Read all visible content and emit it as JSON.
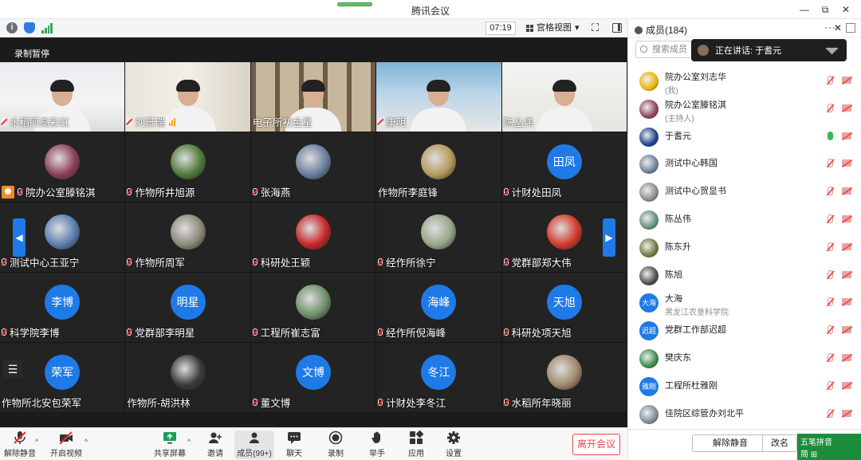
{
  "window": {
    "title": "腾讯会议",
    "controls": [
      "—",
      "⧉",
      "✕"
    ]
  },
  "toolbar": {
    "time": "07:19",
    "view_label": "宫格视图",
    "view_caret": "▾",
    "fullscreen": "⛶"
  },
  "recording_status": "录制暂停",
  "tiles": [
    {
      "name": "水稻所高彩虹",
      "type": "camera",
      "scene": "s1"
    },
    {
      "name": "刘景瑞",
      "type": "camera",
      "scene": "s2",
      "bars": true
    },
    {
      "name": "电子所初金星",
      "type": "camera",
      "scene": "s3",
      "nomic": true
    },
    {
      "name": "康明",
      "type": "camera",
      "scene": "s4"
    },
    {
      "name": "陈丛伟",
      "type": "camera",
      "scene": "s5",
      "nomic": true
    },
    {
      "name": "院办公室滕铭淇",
      "type": "avatar",
      "host": true,
      "color": "#8e3f5a"
    },
    {
      "name": "作物所井旭源",
      "type": "avatar",
      "color": "#4f7a3a"
    },
    {
      "name": "张海燕",
      "type": "avatar",
      "color": "#6a7fa0"
    },
    {
      "name": "作物所李庭锋",
      "type": "avatar",
      "nomic": true,
      "color": "#b69a5c"
    },
    {
      "name": "计财处田凤",
      "type": "text",
      "text": "田凤"
    },
    {
      "name": "测试中心王亚宁",
      "type": "avatar",
      "color": "#5a7fb0"
    },
    {
      "name": "作物所周军",
      "type": "avatar",
      "color": "#8d8a7a"
    },
    {
      "name": "科研处王颖",
      "type": "avatar",
      "color": "#c8262a"
    },
    {
      "name": "经作所徐宁",
      "type": "avatar",
      "color": "#9aa68a"
    },
    {
      "name": "党群部郑大伟",
      "type": "avatar",
      "color": "#d33a2c"
    },
    {
      "name": "科学院李博",
      "type": "text",
      "text": "李博"
    },
    {
      "name": "党群部李明星",
      "type": "text",
      "text": "明星"
    },
    {
      "name": "工程所崔志富",
      "type": "avatar",
      "color": "#6f8f6a"
    },
    {
      "name": "经作所倪海峰",
      "type": "text",
      "text": "海峰"
    },
    {
      "name": "科研处项天旭",
      "type": "text",
      "text": "天旭"
    },
    {
      "name": "作物所北安包荣军",
      "type": "text",
      "text": "荣军",
      "nomic": true
    },
    {
      "name": "作物所-胡洪林",
      "type": "avatar",
      "nomic": true,
      "color": "#3a3a3a"
    },
    {
      "name": "董文博",
      "type": "text",
      "text": "文博"
    },
    {
      "name": "计财处李冬江",
      "type": "text",
      "text": "冬江"
    },
    {
      "name": "水稻所年晓丽",
      "type": "avatar",
      "color": "#a08a6a"
    }
  ],
  "nav": {
    "prev": "◀",
    "next": "▶",
    "list": "☰"
  },
  "bottom": {
    "mute": "解除静音",
    "video": "开启视频",
    "share": "共享屏幕",
    "invite": "邀请",
    "members": "成员(99+)",
    "chat": "聊天",
    "record": "录制",
    "raise": "举手",
    "apps": "应用",
    "settings": "设置",
    "leave": "离开会议",
    "caret": "^"
  },
  "panel": {
    "title": "成员(184)",
    "ops": "···",
    "close": "✕",
    "search_placeholder": "搜索成员",
    "speaking": "正在讲话: 于耆元",
    "members": [
      {
        "name": "院办公室刘志华",
        "sub": "(我)",
        "color": "#e8b400",
        "mic": "off"
      },
      {
        "name": "院办公室滕铭淇",
        "sub": "(主持人)",
        "color": "#8e3f5a",
        "mic": "off"
      },
      {
        "name": "于耆元",
        "sub": "",
        "color": "#1a3f8a",
        "mic": "on"
      },
      {
        "name": "测试中心韩国",
        "sub": "",
        "color": "#6a7f94",
        "mic": "off"
      },
      {
        "name": "测试中心贺显书",
        "sub": "",
        "color": "#8a8a8a",
        "mic": "off"
      },
      {
        "name": "陈丛伟",
        "sub": "",
        "color": "#5f8f7a",
        "mic": "off"
      },
      {
        "name": "陈东升",
        "sub": "",
        "color": "#6a7a3a",
        "mic": "off"
      },
      {
        "name": "陈旭",
        "sub": "",
        "color": "#4a4a4a",
        "mic": "off"
      },
      {
        "name": "大海",
        "sub": "黑龙江农垦科学院",
        "text": "大海",
        "mic": "off"
      },
      {
        "name": "党群工作部迟超",
        "sub": "",
        "text": "迟超",
        "mic": "off"
      },
      {
        "name": "樊庆东",
        "sub": "",
        "color": "#3a8a4a",
        "mic": "off"
      },
      {
        "name": "工程所杜雅刚",
        "sub": "",
        "text": "雅刚",
        "mic": "off"
      },
      {
        "name": "佳院区综管办刘北平",
        "sub": "",
        "color": "#7a8a9a",
        "mic": "off"
      }
    ],
    "unmute_all": "解除静音",
    "rename": "改名"
  },
  "ime": {
    "line1": "五笔拼音",
    "line2": "简 ⊞"
  }
}
